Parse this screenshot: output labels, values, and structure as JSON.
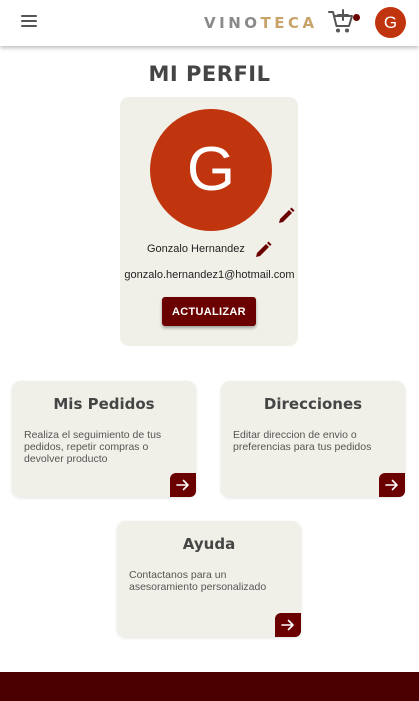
{
  "header": {
    "brand_part1": "VINO",
    "brand_part2": "TECA",
    "avatar_initial": "G",
    "icons": [
      "menu-icon",
      "add-cart-icon",
      "notification-dot"
    ]
  },
  "page": {
    "title": "MI PERFIL"
  },
  "profile": {
    "avatar_initial": "G",
    "name": "Gonzalo Hernandez",
    "email": "gonzalo.hernandez1@hotmail.com",
    "update_label": "ACTUALIZAR"
  },
  "cards": [
    {
      "title": "Mis Pedidos",
      "description": "Realiza el seguimiento de tus pedidos, repetir compras o devolver producto"
    },
    {
      "title": "Direcciones",
      "description": "Editar direccion de envio o preferencias para tus pedidos"
    },
    {
      "title": "Ayuda",
      "description": "Contactanos para un asesoramiento personalizado"
    }
  ],
  "colors": {
    "accent": "#6b0000",
    "avatar": "#c1350e",
    "card_bg": "#f1f0e8",
    "brand_gold": "#c8a46a",
    "footer": "#4a0000"
  }
}
